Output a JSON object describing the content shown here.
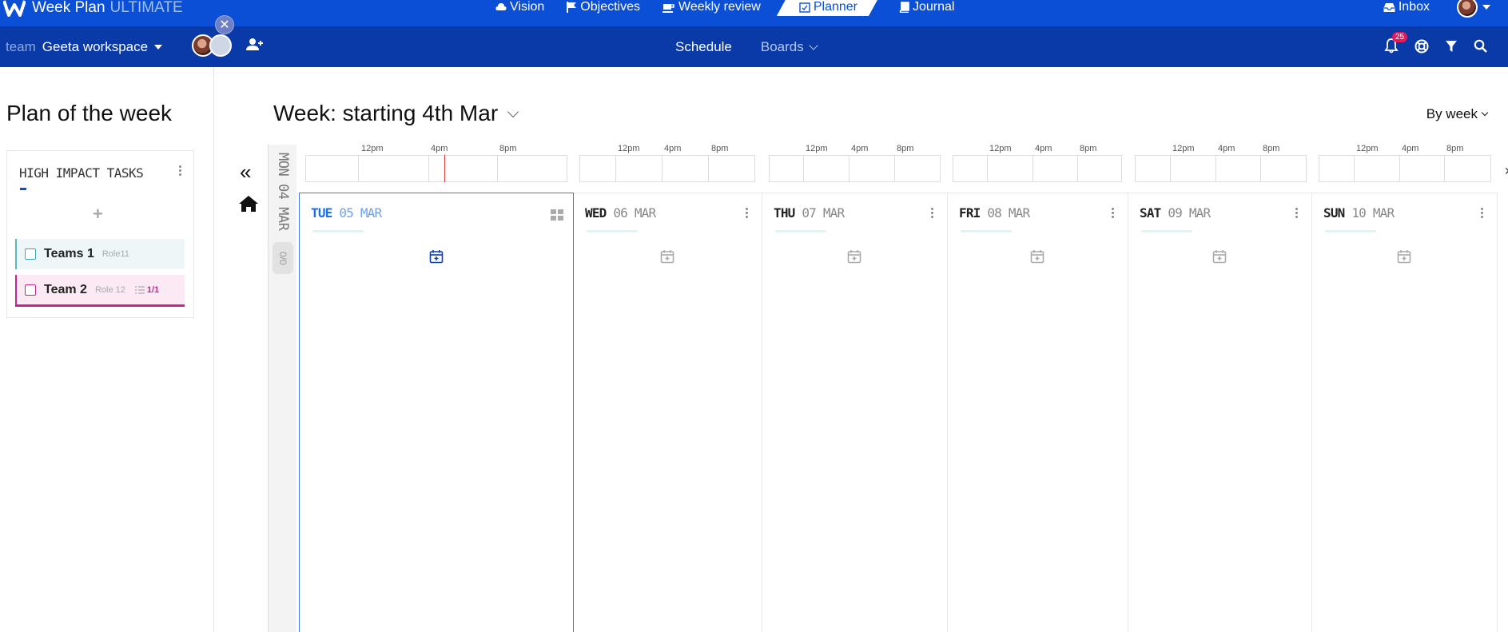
{
  "app": {
    "name": "Week Plan",
    "tier": "ULTIMATE"
  },
  "nav": {
    "vision": "Vision",
    "objectives": "Objectives",
    "weekly_review": "Weekly review",
    "planner": "Planner",
    "journal": "Journal"
  },
  "top_right": {
    "inbox": "Inbox"
  },
  "workspace": {
    "prefix": "team",
    "name": "Geeta workspace"
  },
  "subnav": {
    "schedule": "Schedule",
    "boards": "Boards"
  },
  "notifications": {
    "count": "25"
  },
  "left": {
    "title": "Plan of the week",
    "card_title": "HIGH IMPACT TASKS",
    "add_symbol": "+",
    "tasks": [
      {
        "name": "Teams 1",
        "role": "Role11"
      },
      {
        "name": "Team 2",
        "role": "Role 12",
        "count": "1/1"
      }
    ]
  },
  "week": {
    "title": "Week: starting 4th Mar",
    "view": "By week",
    "collapse_symbol": "«"
  },
  "monday": {
    "label": "MON 04 MAR",
    "count": "0/0"
  },
  "timeline": {
    "labels": [
      "12pm",
      "4pm",
      "8pm"
    ]
  },
  "days": [
    {
      "dow": "TUE",
      "date": "05 MAR",
      "today": true
    },
    {
      "dow": "WED",
      "date": "06 MAR"
    },
    {
      "dow": "THU",
      "date": "07 MAR"
    },
    {
      "dow": "FRI",
      "date": "08 MAR"
    },
    {
      "dow": "SAT",
      "date": "09 MAR"
    },
    {
      "dow": "SUN",
      "date": "10 MAR"
    }
  ],
  "colors": {
    "topbar": "#0b4fd6",
    "subbar": "#0a3aa8",
    "today_accent": "#1f6fe8",
    "team1_accent": "#58b7c4",
    "team2_accent": "#c3268d",
    "badge": "#e6195b",
    "now_line": "#e03c3c"
  }
}
